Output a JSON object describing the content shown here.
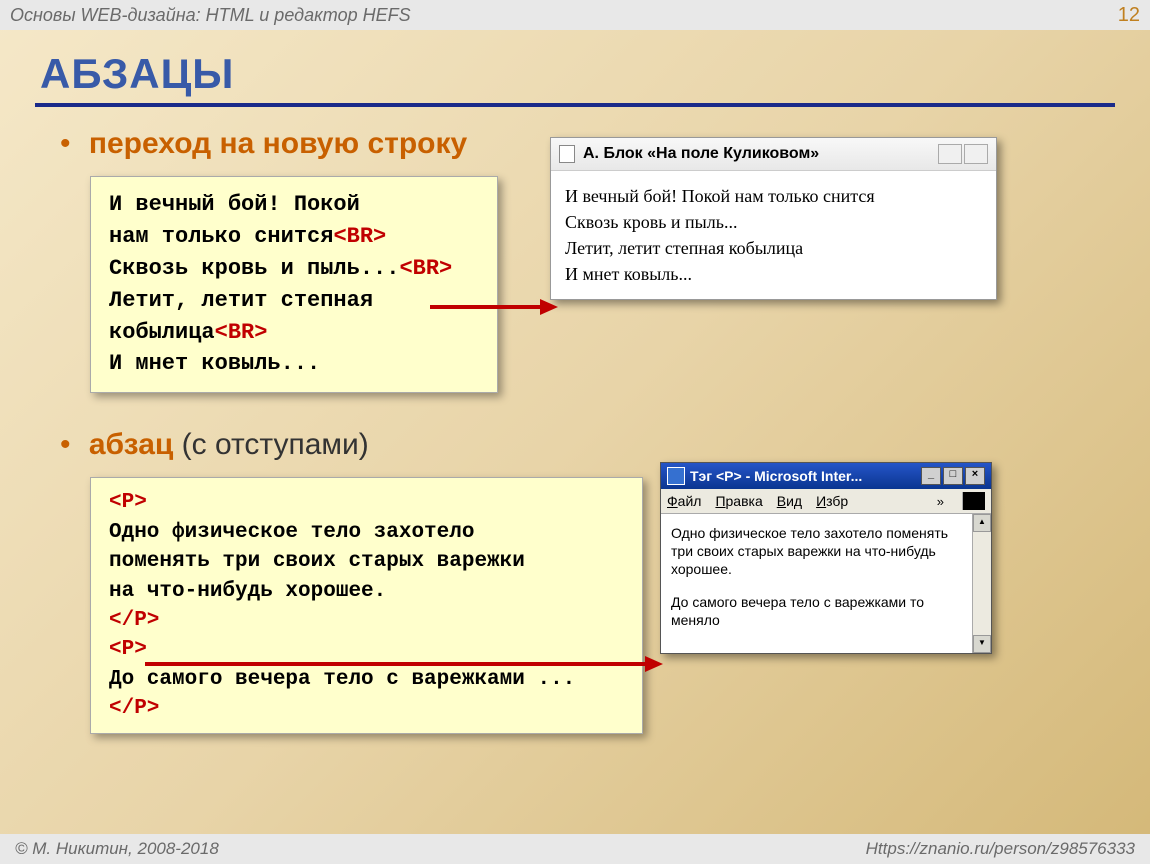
{
  "header": {
    "subject": "Основы WEB-дизайна: HTML и редактор HEFS",
    "page_number": "12"
  },
  "title": "АБЗАЦЫ",
  "section1": {
    "bullet": "переход на новую строку",
    "code": {
      "l1a": "И вечный бой! Покой",
      "l2a": "нам только снится",
      "l2tag": "<BR>",
      "l3a": "Сквозь кровь и пыль...",
      "l3tag": "<BR>",
      "l4a": "Летит, летит степная",
      "l5a": "кобылица",
      "l5tag": "<BR>",
      "l6a": "И мнет ковыль..."
    },
    "preview": {
      "tab_title": "А. Блок «На поле Куликовом»",
      "l1": "И вечный бой! Покой нам только снится",
      "l2": "Сквозь кровь и пыль...",
      "l3": "Летит, летит степная кобылица",
      "l4": "И мнет ковыль..."
    }
  },
  "section2": {
    "bullet_bold": "абзац",
    "bullet_rest": " (с отступами)",
    "code": {
      "t1": "<P>",
      "l1": "Одно физическое тело захотело",
      "l2": "поменять три своих старых варежки",
      "l3": "на что-нибудь хорошее.",
      "t2": "</P>",
      "t3": "<P>",
      "l4": "До самого вечера тело с варежками ...",
      "t4": "</P>"
    },
    "preview": {
      "window_title": "Тэг <P> - Microsoft Inter...",
      "menu": {
        "file": "Файл",
        "edit": "Правка",
        "view": "Вид",
        "fav": "Избр"
      },
      "p1": "Одно физическое тело захотело поменять три своих старых варежки на что-нибудь хорошее.",
      "p2": "До самого вечера тело с варежками то меняло"
    }
  },
  "footer": {
    "left": "© М. Никитин, 2008-2018",
    "right": "Https://znanio.ru/person/z98576333"
  }
}
